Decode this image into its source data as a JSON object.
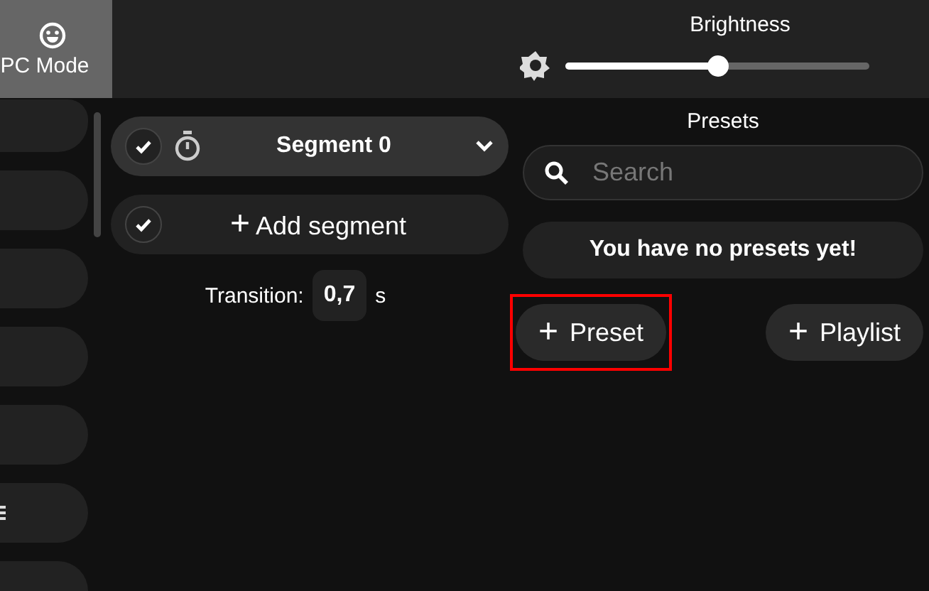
{
  "top_bar": {
    "mode_button": {
      "label": "PC Mode"
    },
    "brightness": {
      "label": "Brightness",
      "level": 0.5
    }
  },
  "segments": [
    {
      "name": "Segment 0",
      "checked": true
    }
  ],
  "add_segment": {
    "label": "Add segment",
    "checked": true
  },
  "transition": {
    "label": "Transition:",
    "value": "0,7",
    "unit": "s"
  },
  "presets": {
    "title": "Presets",
    "search": {
      "placeholder": "Search"
    },
    "empty_message": "You have no presets yet!",
    "buttons": [
      {
        "icon": "+",
        "label": "Preset",
        "highlighted": true
      },
      {
        "icon": "+",
        "label": "Playlist",
        "highlighted": false
      }
    ]
  }
}
